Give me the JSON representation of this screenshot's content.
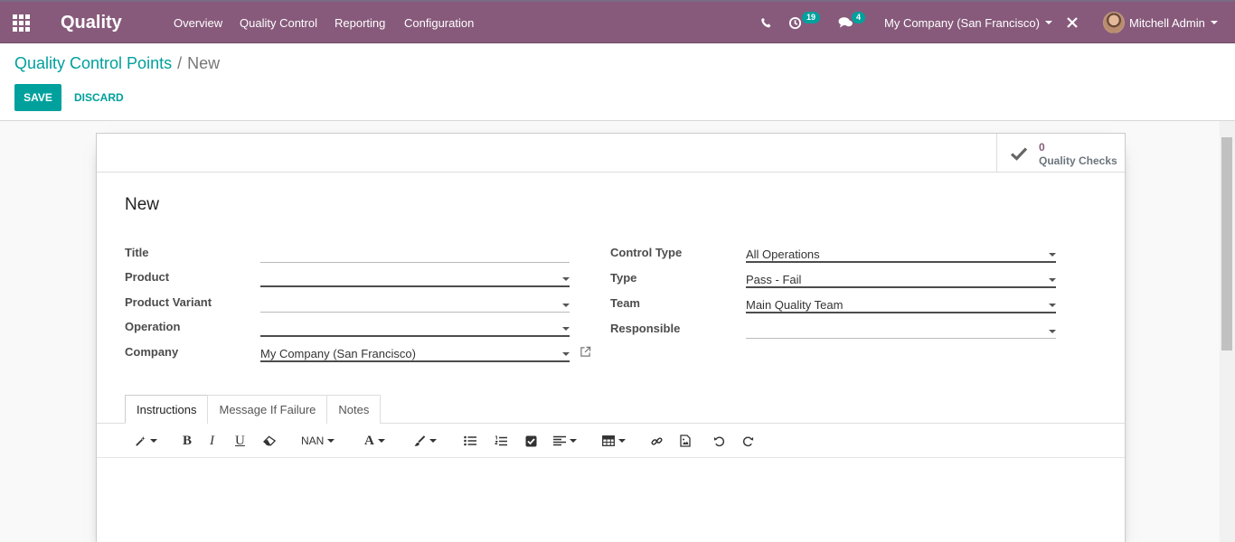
{
  "navbar": {
    "brand": "Quality",
    "menu": [
      "Overview",
      "Quality Control",
      "Reporting",
      "Configuration"
    ],
    "activity_count": "19",
    "message_count": "4",
    "company": "My Company (San Francisco)",
    "user": "Mitchell Admin",
    "color": "#875a7b"
  },
  "breadcrumb": {
    "parent": "Quality Control Points",
    "separator": "/",
    "current": "New"
  },
  "buttons": {
    "save": "SAVE",
    "discard": "DISCARD"
  },
  "smart_button": {
    "value": "0",
    "label": "Quality Checks"
  },
  "record": {
    "title": "New"
  },
  "fields_left": {
    "title": {
      "label": "Title",
      "value": ""
    },
    "product": {
      "label": "Product",
      "value": ""
    },
    "product_variant": {
      "label": "Product Variant",
      "value": ""
    },
    "operation": {
      "label": "Operation",
      "value": ""
    },
    "company": {
      "label": "Company",
      "value": "My Company (San Francisco)"
    }
  },
  "fields_right": {
    "control_type": {
      "label": "Control Type",
      "value": "All Operations"
    },
    "type": {
      "label": "Type",
      "value": "Pass - Fail"
    },
    "team": {
      "label": "Team",
      "value": "Main Quality Team"
    },
    "responsible": {
      "label": "Responsible",
      "value": ""
    }
  },
  "tabs": [
    {
      "label": "Instructions",
      "active": true
    },
    {
      "label": "Message If Failure",
      "active": false
    },
    {
      "label": "Notes",
      "active": false
    }
  ],
  "editor": {
    "font_size_label": "NAN",
    "accent": "#00a09d"
  }
}
